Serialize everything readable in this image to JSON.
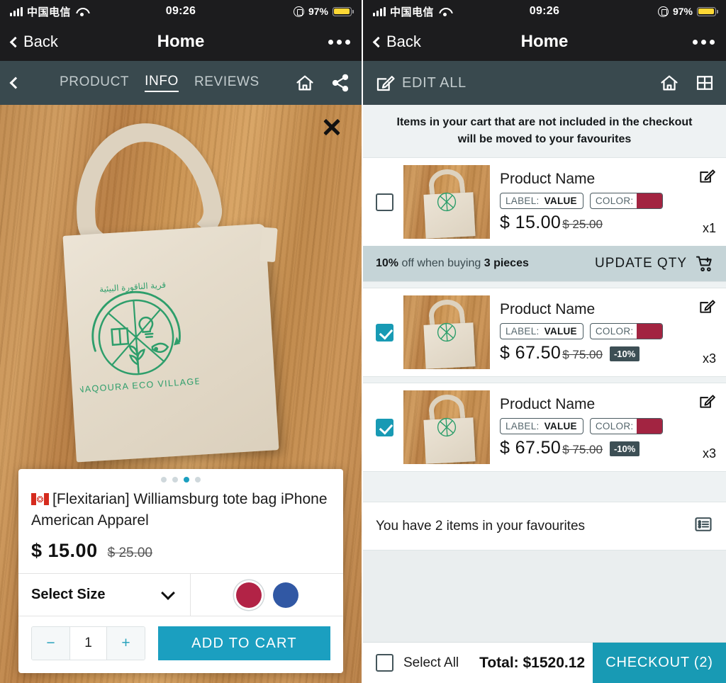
{
  "status_bar": {
    "carrier": "中国电信",
    "time": "09:26",
    "battery_pct": "97%",
    "signal_icon": "signal-bars-icon",
    "wifi_icon": "wifi-icon",
    "orientation_lock_icon": "rotation-lock-icon",
    "battery_icon": "battery-icon"
  },
  "nav": {
    "back_label": "Back",
    "title": "Home",
    "more_icon": "more-dots-icon"
  },
  "left": {
    "tabbar": {
      "back_icon": "chevron-left-icon",
      "tabs": [
        {
          "label": "PRODUCT",
          "active": false
        },
        {
          "label": "INFO",
          "active": true
        },
        {
          "label": "REVIEWS",
          "active": false
        }
      ],
      "home_icon": "home-icon",
      "share_icon": "share-icon"
    },
    "hero": {
      "close_icon": "close-x-icon",
      "logo_text": "NAQOURA ECO VILLAGE",
      "logo_text_arabic": "قرية الناقورة البيئية"
    },
    "card": {
      "carousel_dots": 4,
      "carousel_active_index": 2,
      "flag_icon": "canada-flag-icon",
      "title": "[Flexitarian] Williamsburg tote bag iPhone American Apparel",
      "price_now": "$ 15.00",
      "price_was": "$ 25.00",
      "size_label": "Select Size",
      "size_chevron_icon": "chevron-down-icon",
      "swatches": [
        {
          "name": "crimson",
          "hex": "#b22346",
          "selected": true
        },
        {
          "name": "blue",
          "hex": "#3158a4",
          "selected": false
        }
      ],
      "qty_minus": "−",
      "qty_value": "1",
      "qty_plus": "+",
      "add_to_cart_label": "ADD TO CART"
    }
  },
  "right": {
    "editbar": {
      "edit_icon": "edit-square-icon",
      "edit_all_label": "EDIT ALL",
      "home_icon": "home-icon",
      "grid_icon": "grid-icon"
    },
    "notice": "Items in your cart that are not included in the checkout will be moved to your favourites",
    "cart_items": [
      {
        "checked": false,
        "name": "Product Name",
        "label_key": "LABEL:",
        "label_value": "VALUE",
        "color_key": "COLOR:",
        "color_hex": "#a22441",
        "price_now": "$ 15.00",
        "price_was": "$ 25.00",
        "discount_badge": "",
        "qty": "x1",
        "edit_icon": "edit-square-icon"
      },
      {
        "checked": true,
        "name": "Product Name",
        "label_key": "LABEL:",
        "label_value": "VALUE",
        "color_key": "COLOR:",
        "color_hex": "#a22441",
        "price_now": "$ 67.50",
        "price_was": "$ 75.00",
        "discount_badge": "-10%",
        "qty": "x3",
        "edit_icon": "edit-square-icon"
      },
      {
        "checked": true,
        "name": "Product Name",
        "label_key": "LABEL:",
        "label_value": "VALUE",
        "color_key": "COLOR:",
        "color_hex": "#a22441",
        "price_now": "$ 67.50",
        "price_was": "$ 75.00",
        "discount_badge": "-10%",
        "qty": "x3",
        "edit_icon": "edit-square-icon"
      }
    ],
    "promo": {
      "percent": "10%",
      "text_mid": " off when buying ",
      "pieces": "3 pieces",
      "action_label": "UPDATE QTY",
      "cart_icon": "cart-plus-icon"
    },
    "favourites": {
      "text": "You have 2 items in your favourites",
      "list_icon": "list-icon"
    },
    "bottom": {
      "select_all_label": "Select All",
      "select_all_checked": false,
      "total": "Total: $1520.12",
      "checkout_label": "CHECKOUT (2)"
    }
  },
  "colors": {
    "accent_teal": "#189ab4",
    "header_dark": "#1c1c1e",
    "tabbar_slate": "#39494e",
    "promo_bg": "#c5d4d7",
    "badge_bg": "#3d4f55"
  }
}
